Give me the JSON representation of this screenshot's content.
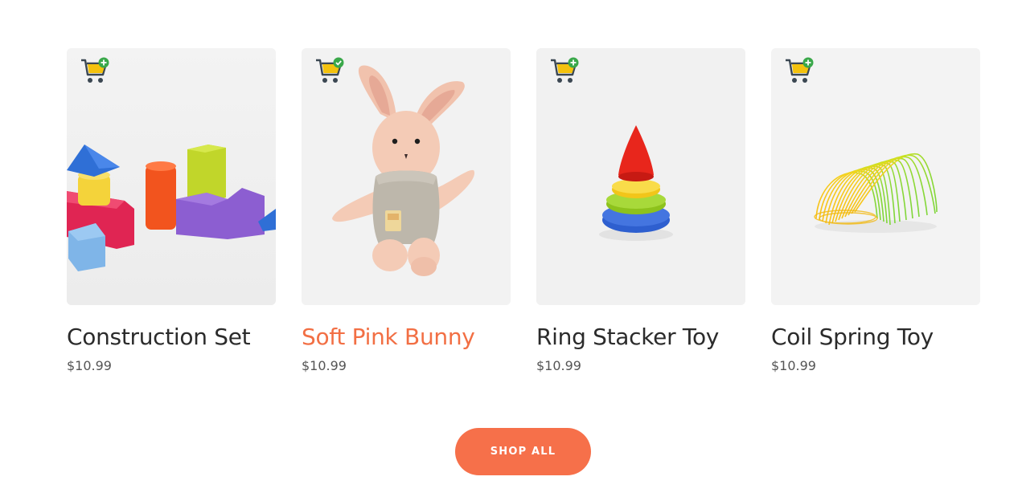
{
  "products": [
    {
      "title": "Construction Set",
      "price": "$10.99",
      "cart_state": "add",
      "image": "toy-blocks-photo"
    },
    {
      "title": "Soft Pink Bunny",
      "price": "$10.99",
      "cart_state": "added",
      "highlighted": true,
      "image": "plush-bunny-photo"
    },
    {
      "title": "Ring Stacker Toy",
      "price": "$10.99",
      "cart_state": "add",
      "image": "ring-stacker-photo"
    },
    {
      "title": "Coil Spring Toy",
      "price": "$10.99",
      "cart_state": "add",
      "image": "coil-spring-photo"
    }
  ],
  "shop_all_label": "SHOP ALL",
  "colors": {
    "accent": "#f6704a",
    "title": "#2b2b2b",
    "price": "#555555",
    "badge_green": "#3aa84a",
    "cart_yellow": "#f4c20d",
    "cart_dark": "#3b4752"
  },
  "icons": [
    "add-to-cart-icon",
    "added-to-cart-icon"
  ]
}
